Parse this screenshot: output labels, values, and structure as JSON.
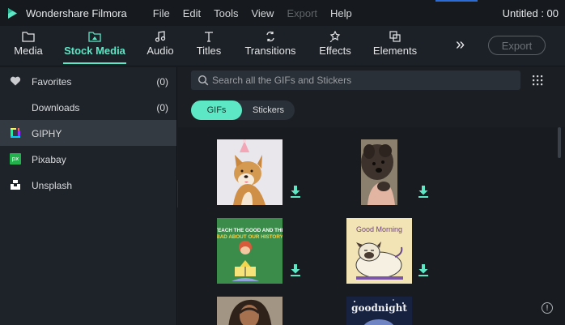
{
  "title_bar": {
    "app_name": "Wondershare Filmora",
    "menu": [
      "File",
      "Edit",
      "Tools",
      "View",
      "Export",
      "Help"
    ],
    "document_title": "Untitled : 00"
  },
  "toolbar": {
    "tabs": [
      {
        "label": "Media",
        "icon": "folder-icon"
      },
      {
        "label": "Stock Media",
        "icon": "stock-folder-icon",
        "active": true
      },
      {
        "label": "Audio",
        "icon": "music-note-icon"
      },
      {
        "label": "Titles",
        "icon": "text-t-icon"
      },
      {
        "label": "Transitions",
        "icon": "transitions-icon"
      },
      {
        "label": "Effects",
        "icon": "effects-icon"
      },
      {
        "label": "Elements",
        "icon": "elements-icon"
      }
    ],
    "more_label": "»",
    "export_label": "Export",
    "accent_color": "#5ee7c5"
  },
  "sidebar": {
    "items": [
      {
        "label": "Favorites",
        "count": "(0)",
        "icon": "heart-icon"
      },
      {
        "label": "Downloads",
        "count": "(0)",
        "icon": ""
      },
      {
        "label": "GIPHY",
        "count": "",
        "icon": "giphy-icon",
        "selected": true
      },
      {
        "label": "Pixabay",
        "count": "",
        "icon": "pixabay-icon"
      },
      {
        "label": "Unsplash",
        "count": "",
        "icon": "unsplash-icon"
      }
    ],
    "pixabay_badge": "px",
    "collapse_label": "◀"
  },
  "content": {
    "search_placeholder": "Search all the GIFs and Stickers",
    "filters": [
      "GIFs",
      "Stickers"
    ],
    "active_filter": "GIFs",
    "thumbnails": [
      {
        "name": "shiba-party-hat-gif"
      },
      {
        "name": "dog-paw-gif"
      },
      {
        "name": "teach-kids-reading-gif",
        "caption": "TEACH THE GOOD AND THE BAD ABOUT OUR HISTORY"
      },
      {
        "name": "good-morning-pug-gif",
        "caption": "Good Morning"
      },
      {
        "name": "man-portrait-gif"
      },
      {
        "name": "goodnight-gif",
        "caption": "goodnight"
      }
    ],
    "info_label": "!"
  }
}
